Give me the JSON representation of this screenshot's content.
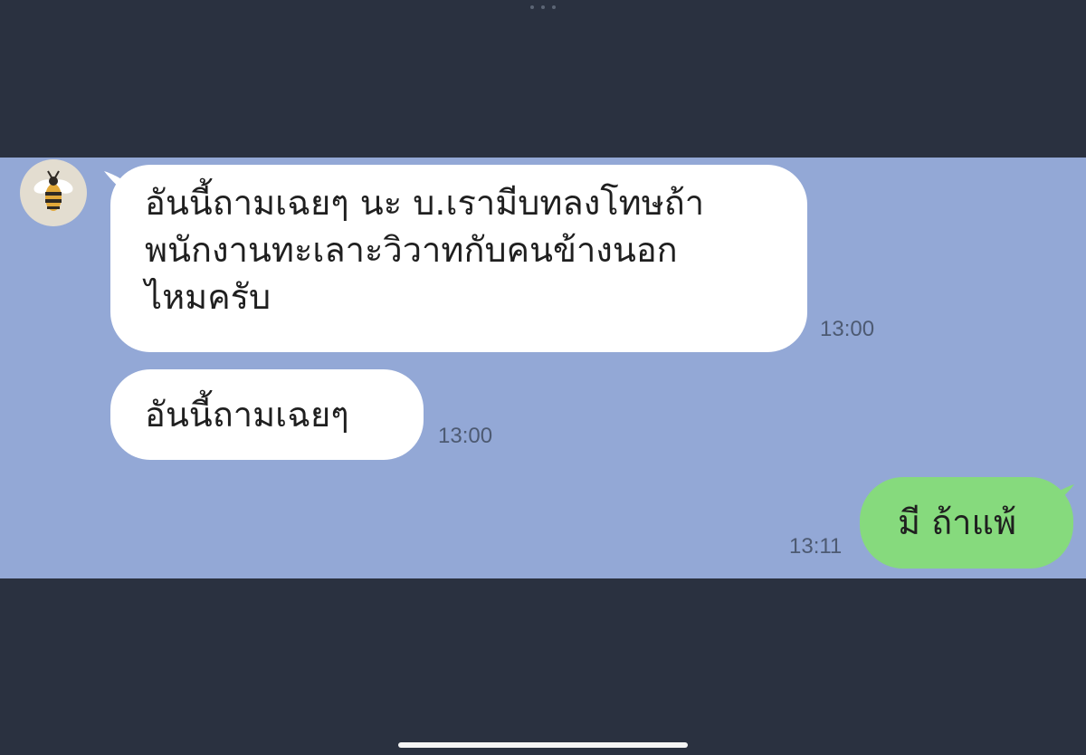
{
  "messages": [
    {
      "direction": "incoming",
      "lines": [
        "อันนี้ถามเฉยๆ นะ บ.เรามีบทลงโทษถ้า",
        "พนักงานทะเลาะวิวาทกับคนข้างนอก",
        "ไหมครับ"
      ],
      "time": "13:00"
    },
    {
      "direction": "incoming",
      "lines": [
        "อันนี้ถามเฉยๆ"
      ],
      "time": "13:00"
    },
    {
      "direction": "outgoing",
      "lines": [
        "มี ถ้าแพ้"
      ],
      "time": "13:11"
    }
  ],
  "sender": {
    "avatar_icon": "bee-icon"
  },
  "colors": {
    "background": "#2a3140",
    "chat_background": "#93a8d6",
    "incoming_bubble": "#ffffff",
    "outgoing_bubble": "#86da7d"
  }
}
